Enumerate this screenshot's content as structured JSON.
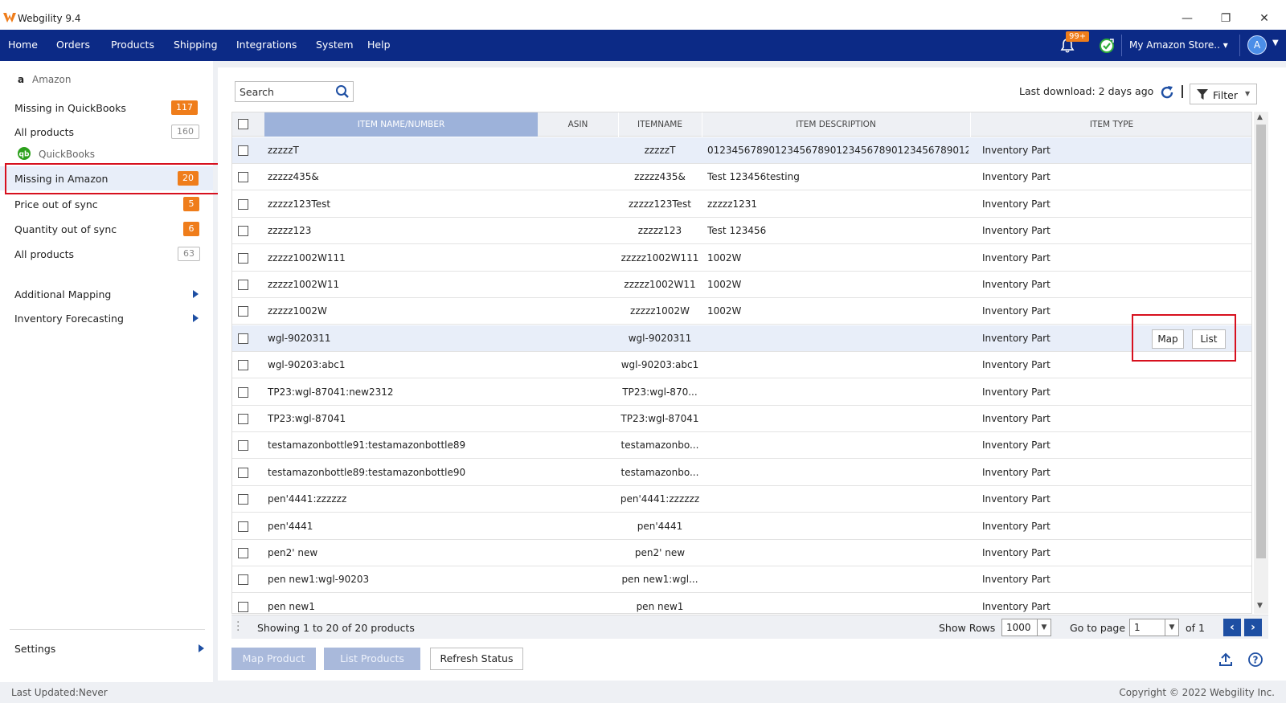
{
  "titlebar": {
    "title": "Webgility 9.4",
    "minimize": "—",
    "restore": "❐",
    "close": "✕"
  },
  "menu": {
    "items": [
      "Home",
      "Orders",
      "Products",
      "Shipping",
      "Integrations",
      "System",
      "Help"
    ],
    "notif_count": "99+",
    "store": "My Amazon Store.. ▾",
    "avatar": "A"
  },
  "sidebar": {
    "amazon_group": "Amazon",
    "amazon_items": [
      {
        "label": "Missing in QuickBooks",
        "count": "117"
      },
      {
        "label": "All products",
        "count": "160"
      }
    ],
    "qb_group": "QuickBooks",
    "qb_items": [
      {
        "label": "Missing in Amazon",
        "count": "20"
      },
      {
        "label": "Price out of sync",
        "count": "5"
      },
      {
        "label": "Quantity out of sync",
        "count": "6"
      },
      {
        "label": "All products",
        "count": "63"
      }
    ],
    "extra": [
      "Additional Mapping",
      "Inventory Forecasting"
    ],
    "settings": "Settings"
  },
  "toolbar": {
    "search_placeholder": "Search",
    "last_download": "Last download: 2 days ago",
    "filter": "Filter"
  },
  "table": {
    "headers": [
      "ITEM NAME/NUMBER",
      "ASIN",
      "ITEMNAME",
      "ITEM DESCRIPTION",
      "ITEM TYPE"
    ],
    "rows": [
      {
        "name": "zzzzzT",
        "itemname": "zzzzzT",
        "desc": "01234567890123456789012345678901234567890123...",
        "type": "Inventory Part"
      },
      {
        "name": "zzzzz435&",
        "itemname": "zzzzz435&",
        "desc": "Test 123456testing",
        "type": "Inventory Part"
      },
      {
        "name": "zzzzz123Test",
        "itemname": "zzzzz123Test",
        "desc": "zzzzz1231",
        "type": "Inventory Part"
      },
      {
        "name": "zzzzz123",
        "itemname": "zzzzz123",
        "desc": "Test 123456",
        "type": "Inventory Part"
      },
      {
        "name": "zzzzz1002W111",
        "itemname": "zzzzz1002W111",
        "desc": "1002W",
        "type": "Inventory Part"
      },
      {
        "name": "zzzzz1002W11",
        "itemname": "zzzzz1002W11",
        "desc": "1002W",
        "type": "Inventory Part"
      },
      {
        "name": "zzzzz1002W",
        "itemname": "zzzzz1002W",
        "desc": "1002W",
        "type": "Inventory Part"
      },
      {
        "name": "wgl-9020311",
        "itemname": "wgl-9020311",
        "desc": "",
        "type": "Inventory Part"
      },
      {
        "name": "wgl-90203:abc1",
        "itemname": "wgl-90203:abc1",
        "desc": "",
        "type": "Inventory Part"
      },
      {
        "name": "TP23:wgl-87041:new2312",
        "itemname": "TP23:wgl-870...",
        "desc": "",
        "type": "Inventory Part"
      },
      {
        "name": "TP23:wgl-87041",
        "itemname": "TP23:wgl-87041",
        "desc": "",
        "type": "Inventory Part"
      },
      {
        "name": "testamazonbottle91:testamazonbottle89",
        "itemname": "testamazonbo...",
        "desc": "",
        "type": "Inventory Part"
      },
      {
        "name": "testamazonbottle89:testamazonbottle90",
        "itemname": "testamazonbo...",
        "desc": "",
        "type": "Inventory Part"
      },
      {
        "name": "pen'4441:zzzzzz",
        "itemname": "pen'4441:zzzzzz",
        "desc": "",
        "type": "Inventory Part"
      },
      {
        "name": "pen'4441",
        "itemname": "pen'4441",
        "desc": "",
        "type": "Inventory Part"
      },
      {
        "name": "pen2' new",
        "itemname": "pen2' new",
        "desc": "",
        "type": "Inventory Part"
      },
      {
        "name": "pen new1:wgl-90203",
        "itemname": "pen new1:wgl...",
        "desc": "",
        "type": "Inventory Part"
      },
      {
        "name": "pen new1",
        "itemname": "pen new1",
        "desc": "",
        "type": "Inventory Part"
      }
    ],
    "row_actions": {
      "map": "Map",
      "list": "List"
    }
  },
  "footer": {
    "showing": "Showing 1 to 20 of 20 products",
    "show_rows_label": "Show Rows",
    "show_rows_value": "1000",
    "goto_label": "Go to page",
    "goto_value": "1",
    "of_pages": "of 1"
  },
  "actions": {
    "map_product": "Map Product",
    "list_products": "List Products",
    "refresh_status": "Refresh Status"
  },
  "statusbar": {
    "last_updated": "Last Updated:Never",
    "copyright": "Copyright © 2022 Webgility Inc."
  },
  "colors": {
    "navy": "#0c2a86",
    "orange": "#ef7d1b",
    "highlight_red": "#d7101e",
    "row_highlight": "#e8eef9"
  }
}
